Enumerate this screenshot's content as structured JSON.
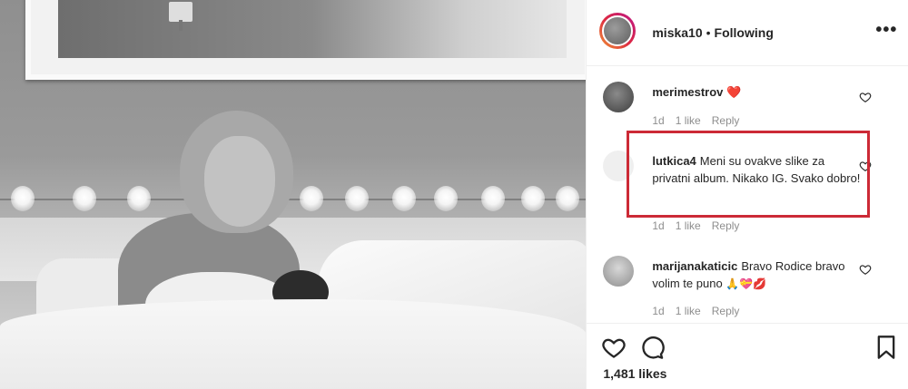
{
  "header": {
    "username": "miska10",
    "separator": "•",
    "follow_status": "Following",
    "more_label": "•••"
  },
  "comments": [
    {
      "username": "merimestrov",
      "text": "",
      "emoji": "❤️",
      "time": "1d",
      "likes": "1 like",
      "reply": "Reply"
    },
    {
      "username": "lutkica4",
      "text": "Meni su ovakve slike za privatni album. Nikako IG. Svako dobro!",
      "time": "1d",
      "likes": "1 like",
      "reply": "Reply"
    },
    {
      "username": "marijanakaticic",
      "text": "Bravo Rodice bravo volim te puno",
      "emoji": "🙏💝💋",
      "time": "1d",
      "likes": "1 like",
      "reply": "Reply"
    }
  ],
  "footer": {
    "likes_count": "1,481 likes"
  },
  "colors": {
    "highlight_border": "#cc2a36",
    "heart_red": "#ed4956",
    "meta_gray": "#8e8e8e"
  },
  "icons": [
    "more-icon",
    "heart-icon",
    "comment-icon",
    "bookmark-icon"
  ]
}
